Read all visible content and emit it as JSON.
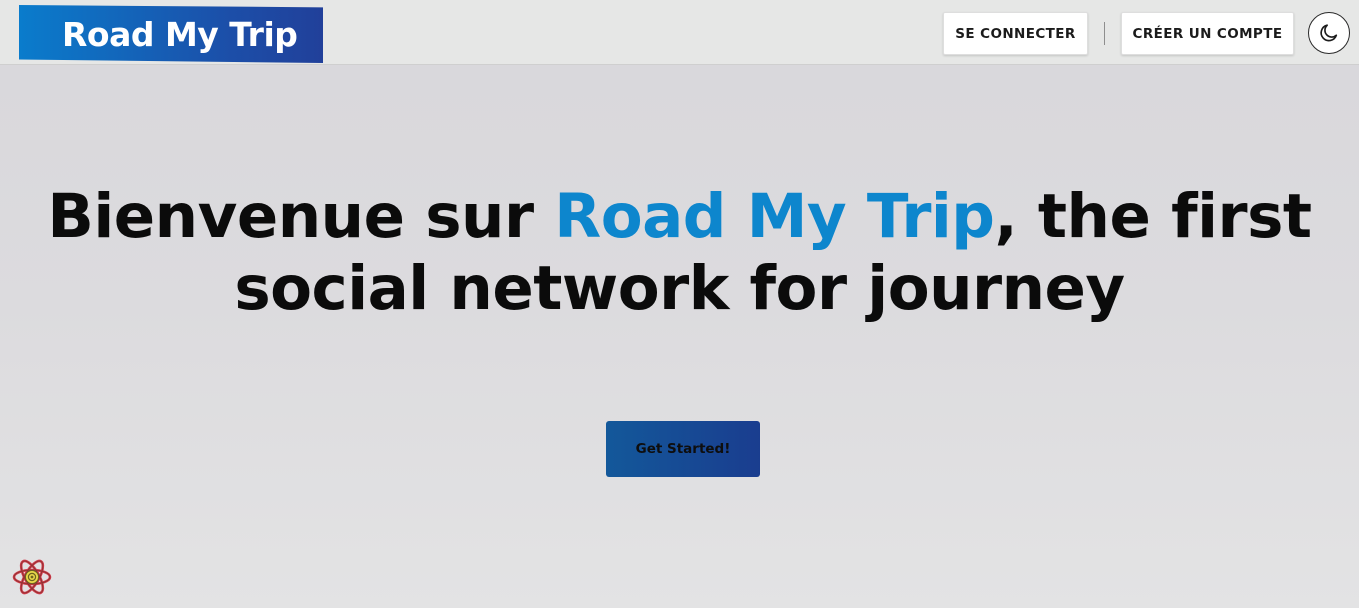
{
  "header": {
    "logo_text": "Road My Trip",
    "login_label": "SE CONNECTER",
    "signup_label": "CRÉER UN COMPTE",
    "theme_toggle_icon": "moon-icon"
  },
  "hero": {
    "title_prefix": "Bienvenue sur ",
    "title_brand": "Road My Trip",
    "title_suffix": ", the first social network for journey",
    "cta_label": "Get Started!"
  },
  "devtools": {
    "icon": "react-devtools-icon"
  },
  "colors": {
    "brand_blue": "#0d86cd",
    "logo_gradient_start": "#0a7ccc",
    "logo_gradient_end": "#21409a",
    "cta_gradient_start": "#13589a",
    "cta_gradient_end": "#1a3d8f",
    "header_bg": "#e6e7e6",
    "page_bg": "#d8d7db"
  }
}
